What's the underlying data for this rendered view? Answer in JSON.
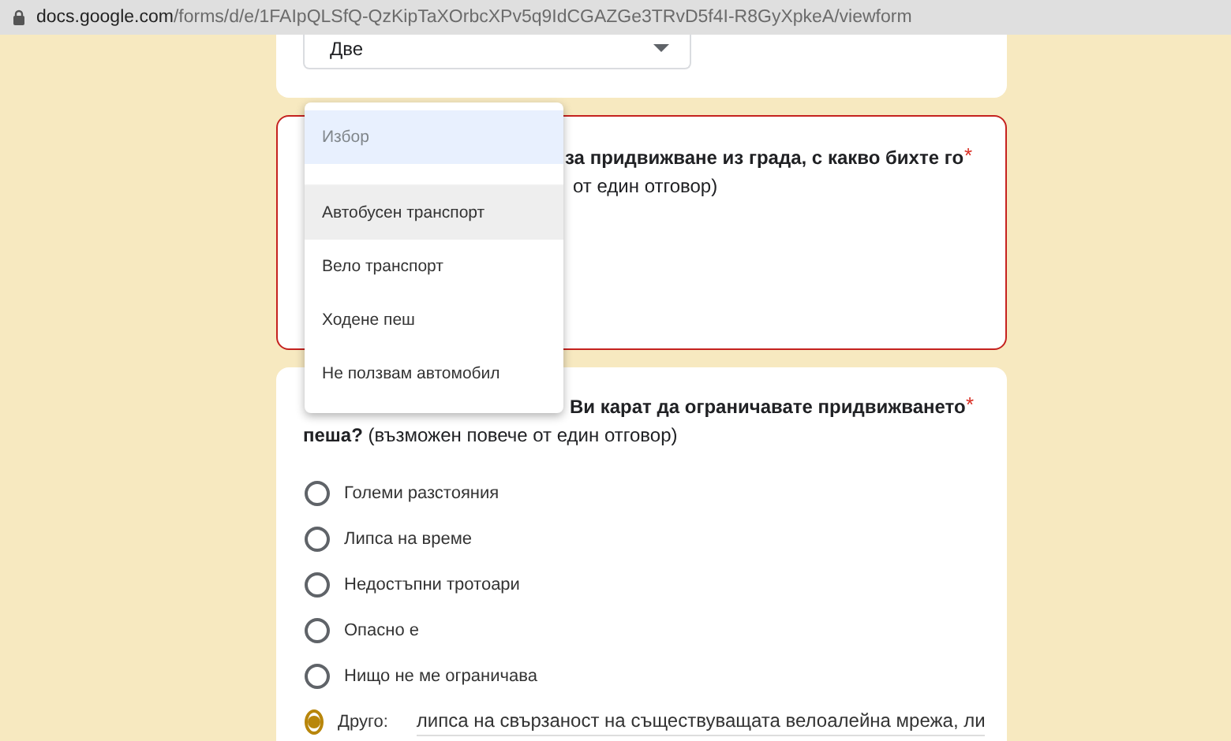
{
  "address_bar": {
    "host": "docs.google.com",
    "path": "/forms/d/e/1FAIpQLSfQ-QzKipTaXOrbcXPv5q9IdCGAZGe3TRvD5f4I-R8GyXpkeA/viewform"
  },
  "card_1": {
    "dropdown": {
      "value": "Две"
    }
  },
  "card_2": {
    "error": true,
    "question_line_1": "за придвижване из града, с какво бихте го",
    "question_line_2": "от един отговор)",
    "required_mark": "*"
  },
  "card_3": {
    "question_line_1": "Ви карат да ограничавате придвижването",
    "question_line_2": "**пеша?** (възможен повече от един отговор)",
    "required_mark": "*",
    "options": [
      {
        "kind": "radio",
        "label": "Големи разстояния",
        "selected": false
      },
      {
        "kind": "radio",
        "label": "Липса на време",
        "selected": false
      },
      {
        "kind": "radio",
        "label": "Недостъпни тротоари",
        "selected": false
      },
      {
        "kind": "radio",
        "label": "Опасно е",
        "selected": false
      },
      {
        "kind": "radio",
        "label": "Нищо не ме ограничава",
        "selected": false
      },
      {
        "kind": "other",
        "label": "Друго:",
        "value": "липса на свързаност на съществуващата велоалейна мрежа, ли",
        "selected": true
      }
    ]
  },
  "dropdown_menu": {
    "items": [
      {
        "label": "Избор",
        "placeholder": true,
        "selected": true,
        "hovered": false
      },
      {
        "label": "Автобусен транспорт",
        "placeholder": false,
        "selected": false,
        "hovered": true
      },
      {
        "label": "Вело транспорт",
        "placeholder": false,
        "selected": false,
        "hovered": false
      },
      {
        "label": "Ходене пеш",
        "placeholder": false,
        "selected": false,
        "hovered": false
      },
      {
        "label": "Не ползвам автомобил",
        "placeholder": false,
        "selected": false,
        "hovered": false
      }
    ]
  }
}
